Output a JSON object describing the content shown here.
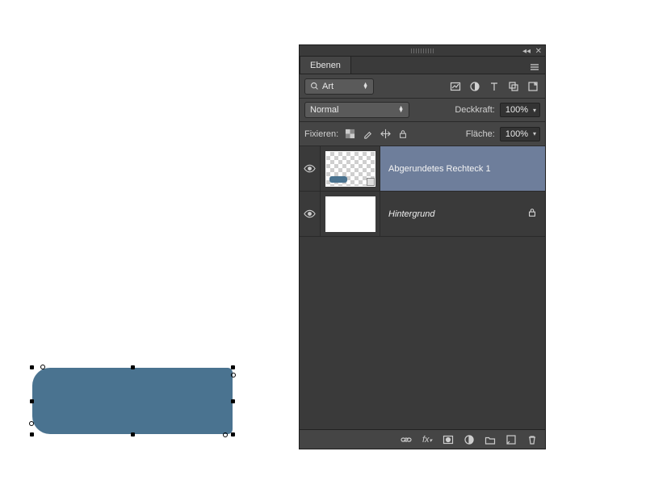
{
  "panel": {
    "tab_title": "Ebenen",
    "filter": {
      "kind": "Art"
    },
    "blend": {
      "mode": "Normal",
      "opacity_label": "Deckkraft:",
      "opacity_value": "100%"
    },
    "lock": {
      "label": "Fixieren:",
      "fill_label": "Fläche:",
      "fill_value": "100%"
    },
    "layers": [
      {
        "name": "Abgerundetes Rechteck 1",
        "visible": true,
        "selected": true,
        "is_bg": false
      },
      {
        "name": "Hintergrund",
        "visible": true,
        "selected": false,
        "is_bg": true
      }
    ]
  }
}
